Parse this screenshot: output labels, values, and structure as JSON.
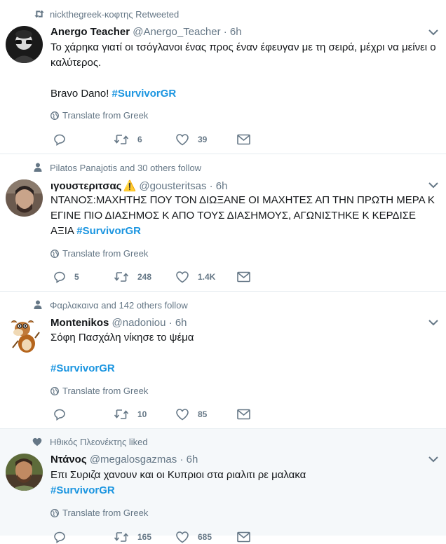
{
  "tweets": [
    {
      "context": "nickthegreek-κοφτης Retweeted",
      "name": "Anergo Teacher",
      "handle": "@Anergo_Teacher",
      "dot": "·",
      "time": "6h",
      "lines": [
        [
          {
            "t": "Το χάρηκα γιατί οι τσόγλανοι ένας προς έναν έφευγαν με τη σειρά, μέχρι να μείνει ο"
          }
        ],
        [
          {
            "t": "καλύτερος."
          }
        ],
        [
          {
            "t": " "
          }
        ],
        [
          {
            "t": "Bravo Dano! "
          },
          {
            "t": "#SurvivorGR",
            "tag": true
          }
        ]
      ],
      "translate": "Translate from Greek",
      "replies": "",
      "retweets": "6",
      "likes": "39"
    },
    {
      "context": "Pilatos Panajotis and 30 others follow",
      "name": "ιγουστεριτσας",
      "emoji": "⚠️",
      "handle": "@gousteritsas",
      "dot": "·",
      "time": "6h",
      "lines": [
        [
          {
            "t": "ΝΤΑΝΟΣ:ΜΑΧΗΤΗΣ ΠΟΥ ΤΟΝ ΔΙΩΞΑΝΕ ΟΙ ΜΑΧΗΤΕΣ ΑΠ ΤΗΝ ΠΡΩΤΗ ΜΕΡΑ Κ"
          }
        ],
        [
          {
            "t": "ΕΓΙΝΕ ΠΙΟ ΔΙΑΣΗΜΟΣ Κ ΑΠΟ ΤΟΥΣ ΔΙΑΣΗΜΟΥΣ, ΑΓΩΝΙΣΤΗΚΕ Κ ΚΕΡΔΙΣΕ"
          }
        ],
        [
          {
            "t": "ΑΞΙΑ "
          },
          {
            "t": "#SurvivorGR",
            "tag": true
          }
        ]
      ],
      "translate": "Translate from Greek",
      "replies": "5",
      "retweets": "248",
      "likes": "1.4K"
    },
    {
      "context": "Φαρλακαινα and 142 others follow",
      "name": "Montenikos",
      "handle": "@nadoniou",
      "dot": "·",
      "time": "6h",
      "lines": [
        [
          {
            "t": "Σόφη Πασχάλη νίκησε το ψέμα"
          }
        ],
        [
          {
            "t": " "
          }
        ],
        [
          {
            "t": " "
          },
          {
            "t": "#SurvivorGR",
            "tag": true
          }
        ]
      ],
      "translate": "Translate from Greek",
      "replies": "",
      "retweets": "10",
      "likes": "85"
    },
    {
      "context": "Ηθικός Πλεονέκτης liked",
      "name": "Ντάνος",
      "handle": "@megalosgazmas",
      "dot": "·",
      "time": "6h",
      "lines": [
        [
          {
            "t": "Επι Συριζα χανουν και οι Κυπριοι στα ριαλιτι ρε μαλακα"
          }
        ],
        [
          {
            "t": "#SurvivorGR",
            "tag": true
          }
        ]
      ],
      "translate": "Translate from Greek",
      "replies": "",
      "retweets": "165",
      "likes": "685"
    }
  ],
  "colors": {
    "text": "#14171a",
    "secondary": "#657786",
    "hashtag": "#1b95e0",
    "divider": "#e6ecf0",
    "highlight_bg": "#f5f8fa"
  },
  "icons": {
    "context": [
      "retweet-icon",
      "person-icon",
      "person-icon",
      "heart-icon"
    ],
    "actions": [
      "reply-icon",
      "retweet-icon",
      "like-icon",
      "message-icon"
    ],
    "translate": "globe-icon",
    "menu": "chevron-down-icon"
  }
}
